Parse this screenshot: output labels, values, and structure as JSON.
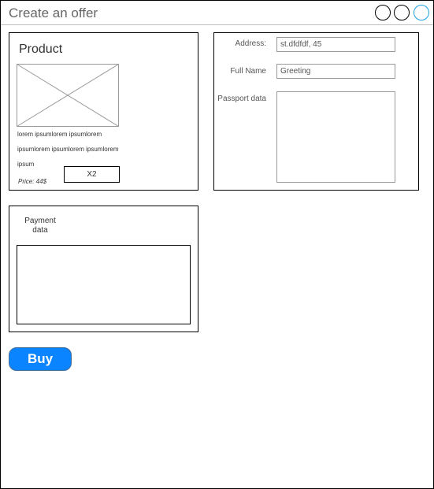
{
  "window": {
    "title": "Create an offer"
  },
  "product": {
    "title": "Product",
    "description_lines": [
      "lorem ipsumlorem ipsumlorem",
      "ipsumlorem ipsumlorem ipsumlorem",
      "ipsum"
    ],
    "quantity": "X2",
    "price": "Price: 44$"
  },
  "form": {
    "address_label": "Address:",
    "address_value": "st.dfdfdf, 45",
    "fullname_label": "Full Name",
    "fullname_value": "Greeting",
    "passport_label": "Passport data",
    "passport_value": ""
  },
  "payment": {
    "label": "Payment data"
  },
  "actions": {
    "buy_label": "Buy"
  },
  "colors": {
    "buy_button": "#0a84ff",
    "window_control_active": "#1ba1e2"
  }
}
